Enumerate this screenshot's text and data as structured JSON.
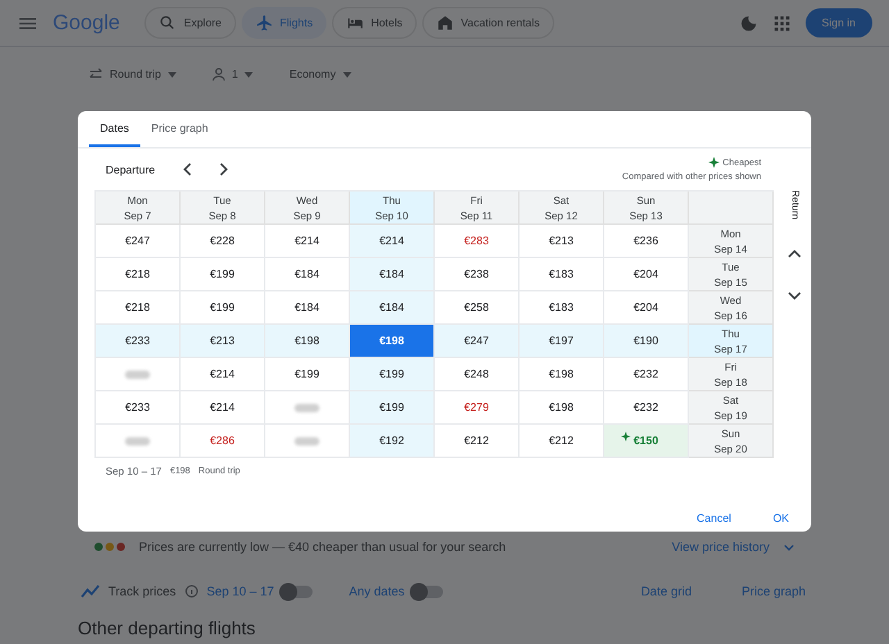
{
  "header": {
    "logo": "Google",
    "nav": [
      {
        "label": "Explore",
        "selected": false
      },
      {
        "label": "Flights",
        "selected": true
      },
      {
        "label": "Hotels",
        "selected": false
      },
      {
        "label": "Vacation rentals",
        "selected": false
      }
    ],
    "sign_in": "Sign in"
  },
  "trip_options": {
    "trip_type": "Round trip",
    "passengers": "1",
    "cabin": "Economy"
  },
  "dialog": {
    "tabs": [
      {
        "label": "Dates",
        "selected": true
      },
      {
        "label": "Price graph",
        "selected": false
      }
    ],
    "departure_label": "Departure",
    "legend": "Cheapest",
    "legend_note": "Compared with other prices shown",
    "return_label": "Return",
    "departures": [
      {
        "day": "Mon",
        "date": "Sep 7",
        "selected": false
      },
      {
        "day": "Tue",
        "date": "Sep 8",
        "selected": false
      },
      {
        "day": "Wed",
        "date": "Sep 9",
        "selected": false
      },
      {
        "day": "Thu",
        "date": "Sep 10",
        "selected": true
      },
      {
        "day": "Fri",
        "date": "Sep 11",
        "selected": false
      },
      {
        "day": "Sat",
        "date": "Sep 12",
        "selected": false
      },
      {
        "day": "Sun",
        "date": "Sep 13",
        "selected": false
      }
    ],
    "rows": [
      {
        "day": "Mon",
        "date": "Sep 14",
        "selected": false,
        "cells": [
          {
            "kind": "normal",
            "price": "€247"
          },
          {
            "kind": "normal",
            "price": "€228"
          },
          {
            "kind": "normal",
            "price": "€214"
          },
          {
            "kind": "normal",
            "price": "€214"
          },
          {
            "kind": "high",
            "price": "€283"
          },
          {
            "kind": "normal",
            "price": "€213"
          },
          {
            "kind": "normal",
            "price": "€236"
          }
        ]
      },
      {
        "day": "Tue",
        "date": "Sep 15",
        "selected": false,
        "cells": [
          {
            "kind": "normal",
            "price": "€218"
          },
          {
            "kind": "normal",
            "price": "€199"
          },
          {
            "kind": "normal",
            "price": "€184"
          },
          {
            "kind": "normal",
            "price": "€184"
          },
          {
            "kind": "normal",
            "price": "€238"
          },
          {
            "kind": "normal",
            "price": "€183"
          },
          {
            "kind": "normal",
            "price": "€204"
          }
        ]
      },
      {
        "day": "Wed",
        "date": "Sep 16",
        "selected": false,
        "cells": [
          {
            "kind": "normal",
            "price": "€218"
          },
          {
            "kind": "normal",
            "price": "€199"
          },
          {
            "kind": "normal",
            "price": "€184"
          },
          {
            "kind": "normal",
            "price": "€184"
          },
          {
            "kind": "normal",
            "price": "€258"
          },
          {
            "kind": "normal",
            "price": "€183"
          },
          {
            "kind": "normal",
            "price": "€204"
          }
        ]
      },
      {
        "day": "Thu",
        "date": "Sep 17",
        "selected": true,
        "cells": [
          {
            "kind": "normal",
            "price": "€233"
          },
          {
            "kind": "normal",
            "price": "€213"
          },
          {
            "kind": "normal",
            "price": "€198"
          },
          {
            "kind": "selected",
            "price": "€198"
          },
          {
            "kind": "normal",
            "price": "€247"
          },
          {
            "kind": "normal",
            "price": "€197"
          },
          {
            "kind": "normal",
            "price": "€190"
          }
        ]
      },
      {
        "day": "Fri",
        "date": "Sep 18",
        "selected": false,
        "cells": [
          {
            "kind": "hidden"
          },
          {
            "kind": "normal",
            "price": "€214"
          },
          {
            "kind": "normal",
            "price": "€199"
          },
          {
            "kind": "normal",
            "price": "€199"
          },
          {
            "kind": "normal",
            "price": "€248"
          },
          {
            "kind": "normal",
            "price": "€198"
          },
          {
            "kind": "normal",
            "price": "€232"
          }
        ]
      },
      {
        "day": "Sat",
        "date": "Sep 19",
        "selected": false,
        "cells": [
          {
            "kind": "normal",
            "price": "€233"
          },
          {
            "kind": "normal",
            "price": "€214"
          },
          {
            "kind": "hidden"
          },
          {
            "kind": "normal",
            "price": "€199"
          },
          {
            "kind": "high",
            "price": "€279"
          },
          {
            "kind": "normal",
            "price": "€198"
          },
          {
            "kind": "normal",
            "price": "€232"
          }
        ]
      },
      {
        "day": "Sun",
        "date": "Sep 20",
        "selected": false,
        "cells": [
          {
            "kind": "hidden"
          },
          {
            "kind": "high",
            "price": "€286"
          },
          {
            "kind": "hidden"
          },
          {
            "kind": "normal",
            "price": "€192"
          },
          {
            "kind": "normal",
            "price": "€212"
          },
          {
            "kind": "normal",
            "price": "€212"
          },
          {
            "kind": "cheapest",
            "price": "€150"
          }
        ]
      }
    ],
    "summary_dates": "Sep 10 – 17",
    "summary_price": "€198",
    "summary_type": "Round trip",
    "cancel": "Cancel",
    "ok": "OK"
  },
  "price_insight": {
    "text": "Prices are currently low — €40 cheaper than usual for your search",
    "link": "View price history"
  },
  "tracking": {
    "label": "Track prices",
    "dates": "Sep 10 – 17",
    "dates_on": false,
    "any_dates": "Any dates",
    "any_on": false,
    "date_grid": "Date grid",
    "price_graph": "Price graph"
  },
  "section_title": "Other departing flights"
}
